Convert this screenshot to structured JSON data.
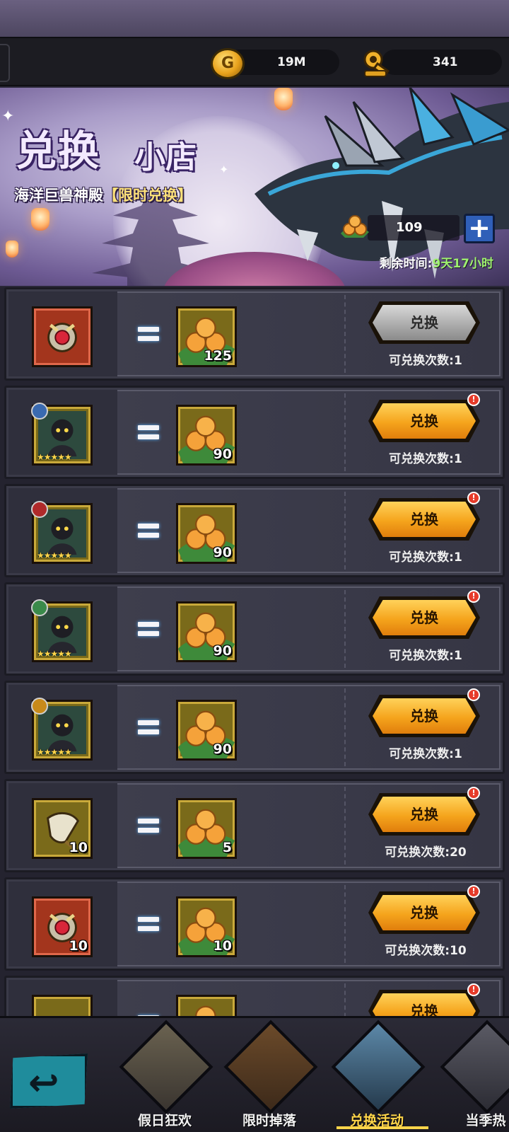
{
  "currency": {
    "gold_value": "19M",
    "key_value": "341",
    "gold_icon_letter": "G"
  },
  "banner": {
    "title_main": "兑换",
    "title_sub": "小店",
    "subtitle_prefix": "海洋巨兽神殿",
    "subtitle_tag": "【限时兑换】",
    "token_count": "109",
    "plus_label": "+",
    "time_label": "剩余时间:",
    "time_value": "9天17小时"
  },
  "rows": [
    {
      "item_qty": "",
      "cost": "125",
      "button": "兑换",
      "limit": "可兑换次数:1",
      "state": "disabled",
      "alert": false,
      "type": "gear-red",
      "stars": ""
    },
    {
      "item_qty": "",
      "cost": "90",
      "button": "兑换",
      "limit": "可兑换次数:1",
      "state": "active",
      "alert": true,
      "type": "hero",
      "stars": "★★★★★"
    },
    {
      "item_qty": "",
      "cost": "90",
      "button": "兑换",
      "limit": "可兑换次数:1",
      "state": "active",
      "alert": true,
      "type": "hero",
      "stars": "★★★★★"
    },
    {
      "item_qty": "",
      "cost": "90",
      "button": "兑换",
      "limit": "可兑换次数:1",
      "state": "active",
      "alert": true,
      "type": "hero",
      "stars": "★★★★★"
    },
    {
      "item_qty": "",
      "cost": "90",
      "button": "兑换",
      "limit": "可兑换次数:1",
      "state": "active",
      "alert": true,
      "type": "hero",
      "stars": "★★★★★"
    },
    {
      "item_qty": "10",
      "cost": "5",
      "button": "兑换",
      "limit": "可兑换次数:20",
      "state": "active",
      "alert": true,
      "type": "scroll",
      "stars": ""
    },
    {
      "item_qty": "10",
      "cost": "10",
      "button": "兑换",
      "limit": "可兑换次数:10",
      "state": "active",
      "alert": true,
      "type": "gear-red",
      "stars": ""
    },
    {
      "item_qty": "",
      "cost": "",
      "button": "兑换",
      "limit": "",
      "state": "active",
      "alert": true,
      "type": "partial",
      "stars": ""
    }
  ],
  "alert_glyph": "!",
  "nav": {
    "back_icon": "↩",
    "tabs": [
      {
        "label": "假日狂欢",
        "active": false
      },
      {
        "label": "限时掉落",
        "active": false
      },
      {
        "label": "兑换活动",
        "active": true
      },
      {
        "label": "当季热",
        "active": false
      }
    ]
  },
  "colors": {
    "button_active": "#f5a41c",
    "button_disabled": "#a9a9a9",
    "time_value": "#9ef06e",
    "alert": "#e63b2a"
  }
}
